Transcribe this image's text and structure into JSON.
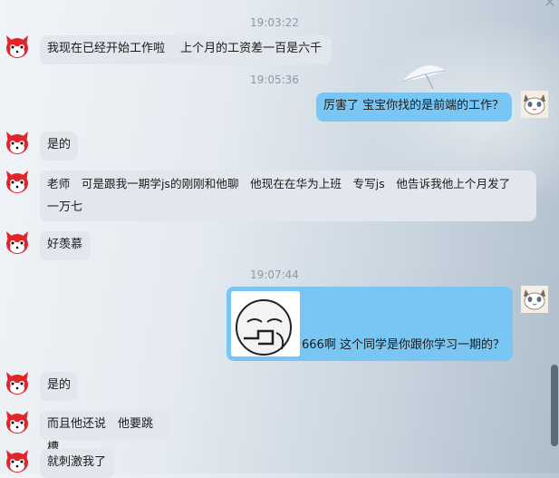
{
  "window": {
    "close_glyph": "×"
  },
  "timestamps": [
    "19:03:22",
    "19:05:36",
    "19:07:44"
  ],
  "messages": [
    {
      "side": "left",
      "text": "我现在已经开始工作啦　  上个月的工资差一百是六千"
    },
    {
      "side": "right",
      "text": "厉害了 宝宝你找的是前端的工作？"
    },
    {
      "side": "left",
      "text": "是的"
    },
    {
      "side": "left",
      "text_line1": "老师　可是跟我一期学js的刚刚和他聊　他现在在华为上班　专写js　他告诉我他上个月发了",
      "text_line2": "一万七"
    },
    {
      "side": "left",
      "text": "好羡慕"
    },
    {
      "side": "right",
      "text": "666啊  这个同学是你跟你学习一期的？",
      "has_sticker": true
    },
    {
      "side": "left",
      "text": "是的"
    },
    {
      "side": "left",
      "text": "而且他还说　他要跳槽"
    },
    {
      "side": "left",
      "text": "就刺激我了"
    }
  ],
  "avatars": {
    "left": "red-fox-avatar-icon",
    "right": "cat-avatar-icon"
  },
  "colors": {
    "left_bubble": "#e2e7ed",
    "right_bubble": "#79c6f4",
    "timestamp": "#8e9aa6"
  }
}
